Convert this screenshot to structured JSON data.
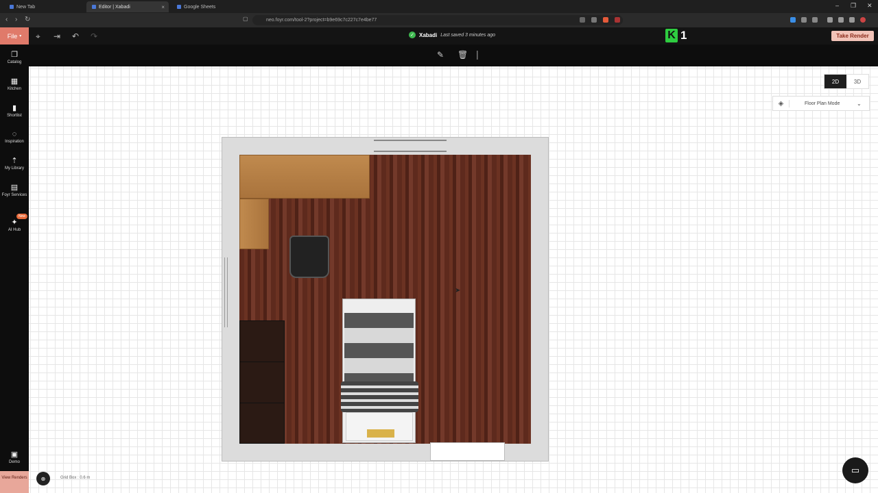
{
  "browser": {
    "tabs": [
      {
        "label": "New Tab"
      },
      {
        "label": "Editor | Xabadi"
      },
      {
        "label": "Google Sheets"
      }
    ],
    "url": "neo.foyr.com/tool-2?project=b9e69c7c227c7e4be77",
    "window_controls": [
      "–",
      "❐",
      "✕"
    ]
  },
  "app": {
    "file_label": "File",
    "project_name": "Xabadi",
    "saved_status": "Last saved 3 minutes ago",
    "badge_letter": "K",
    "badge_number": "1",
    "take_render_label": "Take Render"
  },
  "sidebar": {
    "items": [
      {
        "label": "Catalog",
        "icon": "catalog-icon"
      },
      {
        "label": "Kitchen",
        "icon": "kitchen-icon"
      },
      {
        "label": "Shortlist",
        "icon": "shortlist-icon"
      },
      {
        "label": "Inspiration",
        "icon": "inspiration-icon"
      },
      {
        "label": "My Library",
        "icon": "upload-icon"
      },
      {
        "label": "Foyr Services",
        "icon": "services-icon"
      },
      {
        "label": "AI Hub",
        "icon": "ai-icon",
        "badge": "New"
      },
      {
        "label": "Demo",
        "icon": "demo-icon"
      }
    ],
    "view_renders": "View Renders"
  },
  "view": {
    "toggle_2d": "2D",
    "toggle_3d": "3D",
    "active": "2D",
    "mode_label": "Floor Plan Mode"
  },
  "canvas": {
    "grid_box_label": "Grid Box : 0.6 m"
  },
  "colors": {
    "accent": "#e07a6a",
    "floor": "#5e2a1d",
    "success": "#3fb950"
  }
}
